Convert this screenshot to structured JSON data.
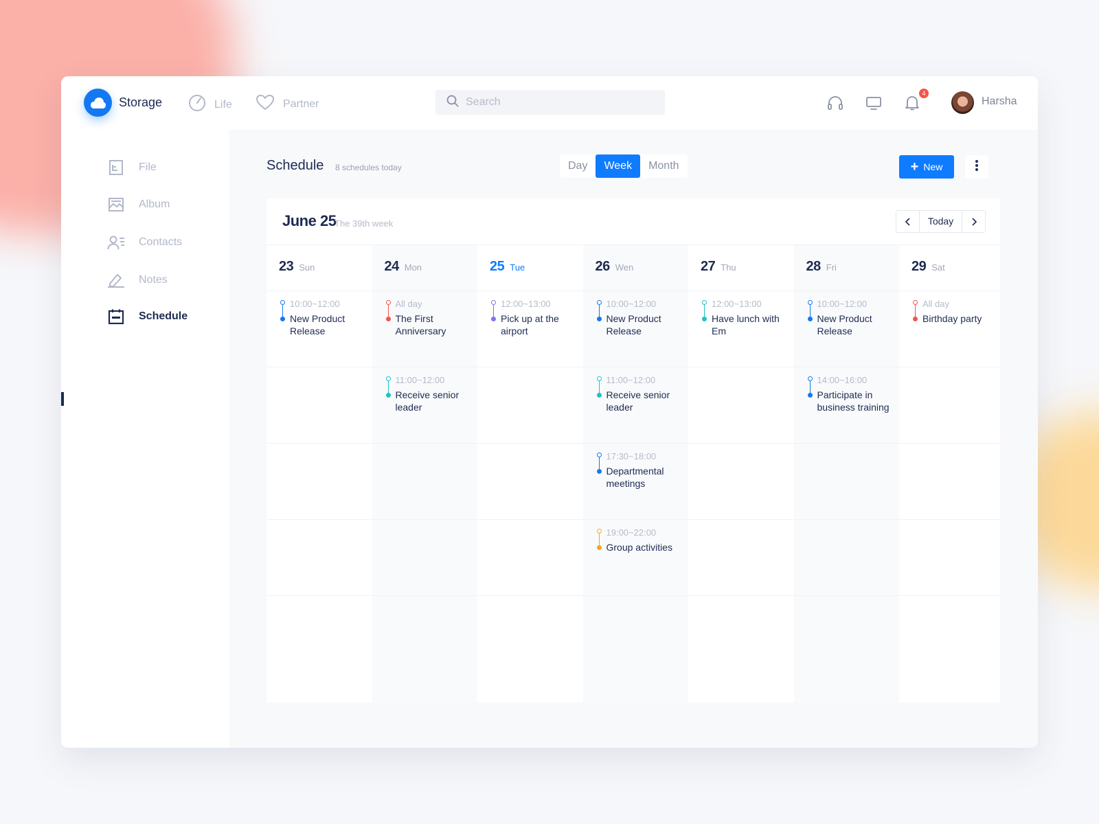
{
  "app": {
    "brand": "Storage",
    "nav": [
      {
        "label": "Life",
        "icon": "timer-icon"
      },
      {
        "label": "Partner",
        "icon": "heart-icon"
      }
    ],
    "search_placeholder": "Search",
    "notifications_count": "4",
    "user_name": "Harsha"
  },
  "sidebar": {
    "items": [
      {
        "label": "File",
        "icon": "file-icon",
        "active": false
      },
      {
        "label": "Album",
        "icon": "image-icon",
        "active": false
      },
      {
        "label": "Contacts",
        "icon": "contacts-icon",
        "active": false
      },
      {
        "label": "Notes",
        "icon": "pen-icon",
        "active": false
      },
      {
        "label": "Schedule",
        "icon": "calendar-icon",
        "active": true
      }
    ]
  },
  "schedule": {
    "title": "Schedule",
    "subtitle": "8 schedules today",
    "views": [
      "Day",
      "Week",
      "Month"
    ],
    "active_view": "Week",
    "new_label": "New",
    "current_date": "June 25",
    "week_label": "The 39th week",
    "today_label": "Today",
    "days": [
      {
        "num": "23",
        "name": "Sun"
      },
      {
        "num": "24",
        "name": "Mon"
      },
      {
        "num": "25",
        "name": "Tue",
        "today": true
      },
      {
        "num": "26",
        "name": "Wen"
      },
      {
        "num": "27",
        "name": "Thu"
      },
      {
        "num": "28",
        "name": "Fri"
      },
      {
        "num": "29",
        "name": "Sat"
      }
    ],
    "events": [
      {
        "day": 0,
        "slot": 0,
        "time": "10:00~12:00",
        "title": "New Product Release",
        "color": "#1478f2"
      },
      {
        "day": 1,
        "slot": 0,
        "time": "All day",
        "title": "The First Anniversary",
        "color": "#f5544a"
      },
      {
        "day": 2,
        "slot": 0,
        "time": "12:00~13:00",
        "title": "Pick up at the airport",
        "color": "#8f6cf2"
      },
      {
        "day": 3,
        "slot": 0,
        "time": "10:00~12:00",
        "title": "New Product Release",
        "color": "#1478f2"
      },
      {
        "day": 4,
        "slot": 0,
        "time": "12:00~13:00",
        "title": "Have lunch with Em",
        "color": "#1ec3c8"
      },
      {
        "day": 5,
        "slot": 0,
        "time": "10:00~12:00",
        "title": "New Product Release",
        "color": "#1478f2"
      },
      {
        "day": 6,
        "slot": 0,
        "time": "All day",
        "title": "Birthday party",
        "color": "#f5544a"
      },
      {
        "day": 1,
        "slot": 1,
        "time": "11:00~12:00",
        "title": "Receive senior leader",
        "color": "#1ec3c8"
      },
      {
        "day": 3,
        "slot": 1,
        "time": "11:00~12:00",
        "title": "Receive senior leader",
        "color": "#1ec3c8"
      },
      {
        "day": 5,
        "slot": 1,
        "time": "14:00~16:00",
        "title": "Participate in business training",
        "color": "#1478f2"
      },
      {
        "day": 3,
        "slot": 2,
        "time": "17:30~18:00",
        "title": "Departmental meetings",
        "color": "#1478f2"
      },
      {
        "day": 3,
        "slot": 3,
        "time": "19:00~22:00",
        "title": "Group activities",
        "color": "#f5a623"
      }
    ]
  },
  "colors": {
    "accent": "#0f7bff",
    "text_primary": "#1d2b52",
    "text_muted": "#b2b8c8"
  }
}
